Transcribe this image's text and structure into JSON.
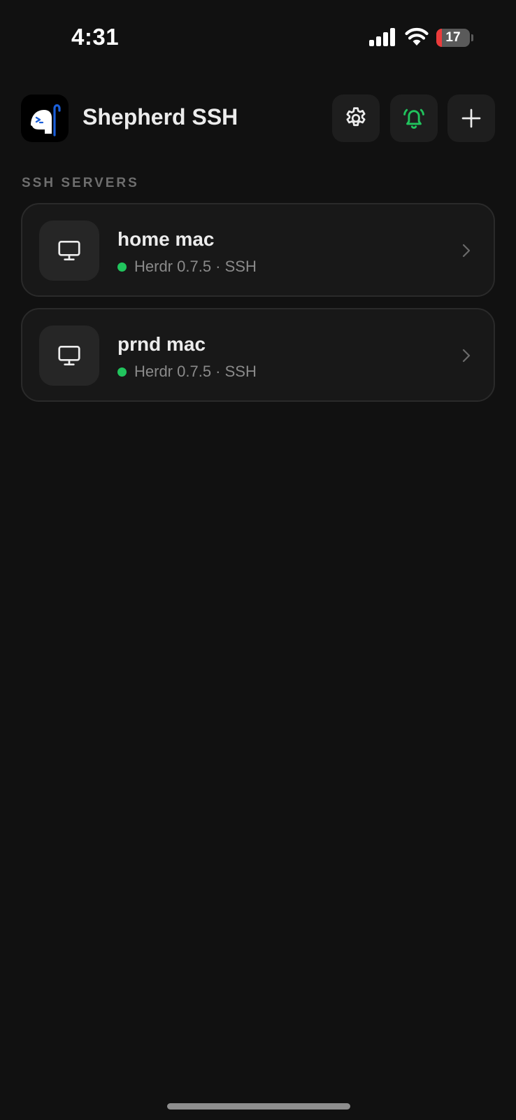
{
  "status_bar": {
    "time": "4:31",
    "battery_level": "17",
    "battery_fraction": 0.17,
    "battery_color": "#EB3B3B"
  },
  "header": {
    "title": "Shepherd SSH",
    "logo_icon": "shepherd-logo-icon",
    "buttons": [
      {
        "name": "settings",
        "icon": "gear-icon"
      },
      {
        "name": "alerts",
        "icon": "bell-ringing-icon",
        "color": "#21C45D"
      },
      {
        "name": "add",
        "icon": "plus-icon"
      }
    ]
  },
  "section": {
    "label": "SSH SERVERS"
  },
  "servers": [
    {
      "name": "home mac",
      "meta": "Herdr 0.7.5 · SSH",
      "status_color": "#21C45D",
      "icon": "desktop-monitor-icon"
    },
    {
      "name": "prnd mac",
      "meta": "Herdr 0.7.5 · SSH",
      "status_color": "#21C45D",
      "icon": "desktop-monitor-icon"
    }
  ],
  "colors": {
    "background": "#111111",
    "card": "#181818",
    "accent_green": "#21C45D"
  }
}
